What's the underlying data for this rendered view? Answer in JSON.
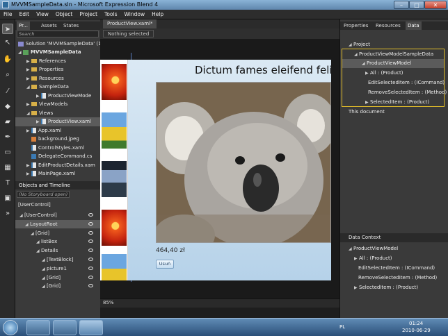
{
  "window": {
    "title": "MVVMSampleData.sln - Microsoft Expression Blend 4"
  },
  "menu": [
    "File",
    "Edit",
    "View",
    "Object",
    "Project",
    "Tools",
    "Window",
    "Help"
  ],
  "left_tabs": {
    "projects": "Pr...",
    "assets": "Assets",
    "states": "States"
  },
  "search_placeholder": "Search",
  "project_tree": {
    "solution": "Solution 'MVVMSampleData' (1",
    "project": "MVVMSampleData",
    "references": "References",
    "properties": "Properties",
    "resources": "Resources",
    "sample_data": "SampleData",
    "product_view_mode": "ProductViewMode",
    "view_models": "ViewModels",
    "views": "Views",
    "product_view_xaml": "ProductView.xaml",
    "app_xaml": "App.xaml",
    "background_jpeg": "background.jpeg",
    "control_styles": "ControlStyles.xaml",
    "delegate_command": "DelegateCommand.cs",
    "edit_product_details": "EditProductDetails.xam",
    "main_page": "MainPage.xaml"
  },
  "objects_timeline": {
    "header": "Objects and Timeline",
    "storyboard": "(No Storyboard open)",
    "scope": "[UserControl]",
    "items": [
      {
        "label": "[UserControl]",
        "indent": 0
      },
      {
        "label": "LayoutRoot",
        "indent": 1
      },
      {
        "label": "[Grid]",
        "indent": 2
      },
      {
        "label": "listBox",
        "indent": 3
      },
      {
        "label": "Details",
        "indent": 3
      },
      {
        "label": "[TextBlock]",
        "indent": 4
      },
      {
        "label": "picture1",
        "indent": 4
      },
      {
        "label": "[Grid]",
        "indent": 4
      },
      {
        "label": "[Grid]",
        "indent": 4
      }
    ]
  },
  "document": {
    "tab": "ProductView.xaml*",
    "breadcrumb": "Nothing selected",
    "product_title": "Dictum fames eleifend felis",
    "price": "464,40 zł",
    "delete_button": "Usuń",
    "zoom": "85%"
  },
  "right_tabs": {
    "properties": "Properties",
    "resources": "Resources",
    "data": "Data"
  },
  "data_panel": {
    "project": "Project",
    "sample_data_source": "ProductViewModelSampleData",
    "view_model": "ProductViewModel",
    "all": "All : (Product)",
    "edit_selected": "EditSelectedItem : (ICommand)",
    "remove_selected": "RemoveSelectedItem : (Method)",
    "selected_item": "SelectedItem : (Product)",
    "this_document": "This document"
  },
  "data_context": {
    "header": "Data Context",
    "view_model": "ProductViewModel",
    "all": "All : (Product)",
    "edit_selected": "EditSelectedItem : (ICommand)",
    "remove_selected": "RemoveSelectedItem : (Method)",
    "selected_item": "SelectedItem : (Product)"
  },
  "taskbar": {
    "language": "PL",
    "time": "01:24",
    "date": "2010-06-29"
  }
}
